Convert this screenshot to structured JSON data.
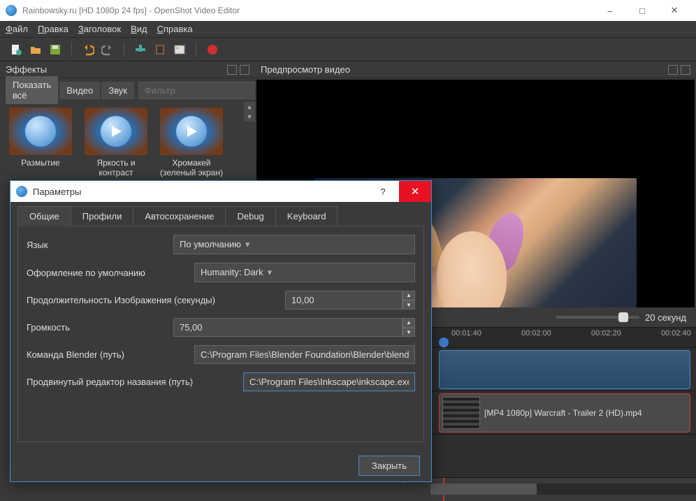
{
  "window": {
    "title": "Rainbowsky.ru [HD 1080p 24 fps] - OpenShot Video Editor"
  },
  "menu": {
    "file": "Файл",
    "edit": "Правка",
    "title_menu": "Заголовок",
    "view": "Вид",
    "help": "Справка"
  },
  "panels": {
    "effects_title": "Эффекты",
    "preview_title": "Предпросмотр видео",
    "filter_placeholder": "Фильтр",
    "tabs": {
      "all": "Показать всё",
      "video": "Видео",
      "audio": "Звук"
    },
    "effects": [
      {
        "label": "Размытие"
      },
      {
        "label": "Яркость и контраст"
      },
      {
        "label": "Хромакей (зеленый экран)"
      }
    ]
  },
  "timeline": {
    "zoom_label": "20 секунд",
    "ticks": [
      "00:01:40",
      "00:02:00",
      "00:02:20",
      "00:02:40"
    ],
    "clip2_label": "[MP4 1080p] Warcraft - Trailer 2 (HD).mp4"
  },
  "dialog": {
    "title": "Параметры",
    "tabs": {
      "general": "Общие",
      "profiles": "Профили",
      "autosave": "Автосохранение",
      "debug": "Debug",
      "keyboard": "Keyboard"
    },
    "labels": {
      "language": "Язык",
      "theme": "Оформление по умолчанию",
      "img_duration": "Продолжительность Изображения (секунды)",
      "volume": "Громкость",
      "blender": "Команда Blender (путь)",
      "advanced_title": "Продвинутый редактор названия (путь)"
    },
    "values": {
      "language": "По умолчанию",
      "theme": "Humanity: Dark",
      "img_duration": "10,00",
      "volume": "75,00",
      "blender": "C:\\Program Files\\Blender Foundation\\Blender\\blender.exe",
      "advanced_title": "C:\\Program Files\\Inkscape\\inkscape.exe"
    },
    "close_btn": "Закрыть"
  }
}
